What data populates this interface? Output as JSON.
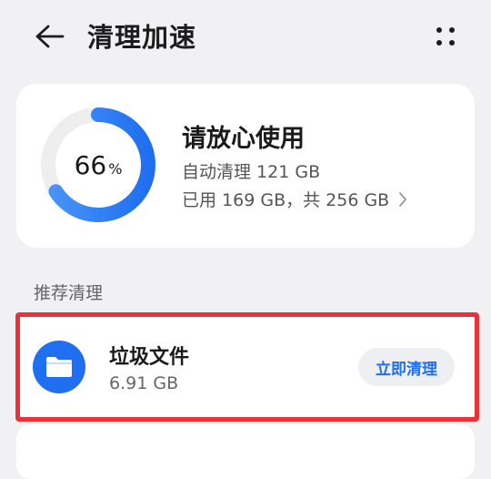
{
  "header": {
    "title": "清理加速"
  },
  "summary": {
    "percent": "66",
    "percent_unit": "%",
    "percent_value": 66,
    "status": "请放心使用",
    "auto_clean": "自动清理 121 GB",
    "usage": "已用 169 GB，共 256 GB"
  },
  "recommend": {
    "section_label": "推荐清理",
    "items": [
      {
        "title": "垃圾文件",
        "size": "6.91 GB",
        "action_label": "立即清理",
        "icon": "folder-icon"
      }
    ]
  },
  "colors": {
    "accent": "#1f6ff0",
    "ring_track": "#eeeeee",
    "highlight_border": "#e8333a"
  }
}
